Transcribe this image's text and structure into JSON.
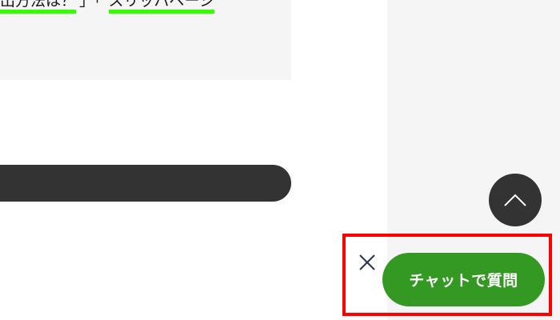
{
  "article": {
    "link1": "出方法は？",
    "separator": "」「",
    "link2": "スリッパページ"
  },
  "back_to_top": {
    "icon": "chevron-up-icon"
  },
  "chat": {
    "close_icon": "close-icon",
    "button_label": "チャットで質問",
    "button_color": "#339922",
    "highlight_color": "#ff0000"
  },
  "colors": {
    "link_underline": "#33ff00",
    "dark_bar": "#333333",
    "panel_bg": "#f5f5f5"
  }
}
